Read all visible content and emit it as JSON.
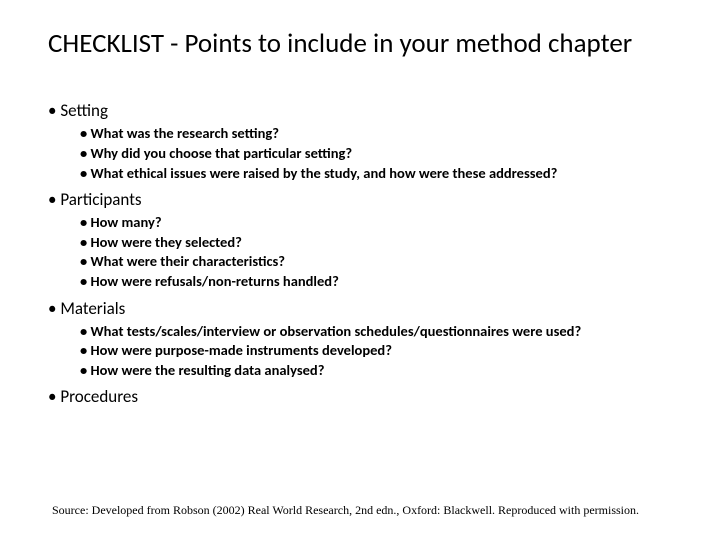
{
  "title": "CHECKLIST - Points to include in your method chapter",
  "sections": [
    {
      "label": "Setting",
      "items": [
        "What was the research setting?",
        "Why did you choose that particular setting?",
        "What ethical issues were raised by the study, and how were these addressed?"
      ]
    },
    {
      "label": "Participants",
      "items": [
        "How many?",
        "How were they selected?",
        "What were their characteristics?",
        "How were refusals/non-returns handled?"
      ]
    },
    {
      "label": "Materials",
      "items": [
        "What tests/scales/interview or observation schedules/questionnaires were used?",
        "How were purpose-made instruments developed?",
        "How were the resulting data analysed?"
      ]
    },
    {
      "label": "Procedures",
      "items": []
    }
  ],
  "source": "Source: Developed from Robson (2002) Real World Research, 2nd edn., Oxford: Blackwell. Reproduced with permission."
}
